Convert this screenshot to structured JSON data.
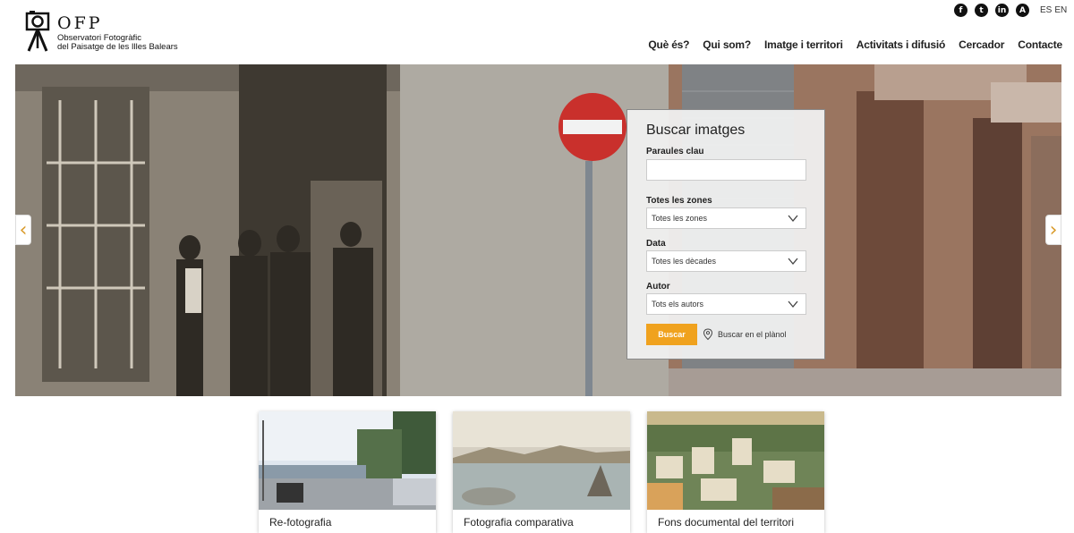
{
  "header": {
    "logo_letters": "OFP",
    "logo_line1": "Observatori Fotogràfic",
    "logo_line2": "del Paisatge de les Illes Balears",
    "social": [
      {
        "icon": "facebook-icon",
        "glyph": "f"
      },
      {
        "icon": "twitter-icon",
        "glyph": "t"
      },
      {
        "icon": "linkedin-icon",
        "glyph": "in"
      },
      {
        "icon": "accessibility-icon",
        "glyph": "A"
      }
    ],
    "languages": [
      "ES",
      "EN"
    ]
  },
  "nav": {
    "items": [
      "Què és?",
      "Qui som?",
      "Imatge i territori",
      "Activitats i difusió",
      "Cercador",
      "Contacte"
    ]
  },
  "hero": {
    "prev_glyph": "‹",
    "next_glyph": "›"
  },
  "search": {
    "title": "Buscar imatges",
    "keywords_label": "Paraules clau",
    "keywords_value": "",
    "zones_label": "Totes les zones",
    "zones_selected": "Totes les zones",
    "date_label": "Data",
    "date_selected": "Totes les dècades",
    "author_label": "Autor",
    "author_selected": "Tots els autors",
    "submit_label": "Buscar",
    "map_link": "Buscar en el plànol"
  },
  "cards": [
    {
      "title": "Re-fotografia"
    },
    {
      "title": "Fotografia comparativa"
    },
    {
      "title": "Fons documental del territori"
    }
  ],
  "colors": {
    "accent": "#f0a21e",
    "arrow": "#d99b2b"
  }
}
